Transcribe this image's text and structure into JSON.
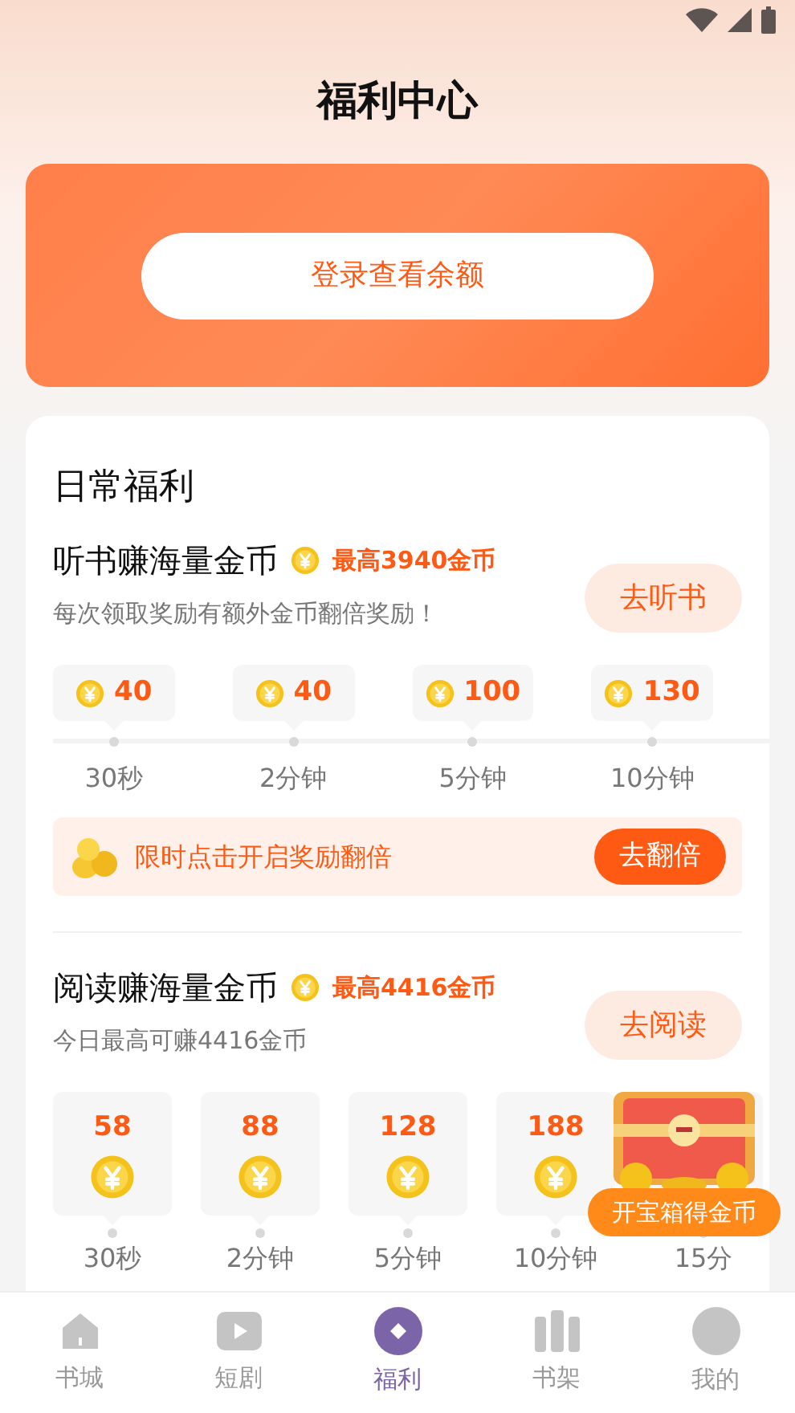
{
  "title": "福利中心",
  "balance_card": {
    "login_button": "登录查看余额"
  },
  "daily": {
    "heading": "日常福利",
    "tasks": [
      {
        "kind": "chips",
        "title": "听书赚海量金币",
        "max_reward": "最高3940金币",
        "subtitle": "每次领取奖励有额外金币翻倍奖励！",
        "button": "去听书",
        "milestones": [
          {
            "reward": "40",
            "time": "30秒"
          },
          {
            "reward": "40",
            "time": "2分钟"
          },
          {
            "reward": "100",
            "time": "5分钟"
          },
          {
            "reward": "130",
            "time": "10分钟"
          }
        ],
        "promo": {
          "text": "限时点击开启奖励翻倍",
          "button": "去翻倍"
        }
      },
      {
        "kind": "cards",
        "title": "阅读赚海量金币",
        "max_reward": "最高4416金币",
        "subtitle": "今日最高可赚4416金币",
        "button": "去阅读",
        "milestones": [
          {
            "reward": "58",
            "time": "30秒"
          },
          {
            "reward": "88",
            "time": "2分钟"
          },
          {
            "reward": "128",
            "time": "5分钟"
          },
          {
            "reward": "188",
            "time": "10分钟"
          },
          {
            "time": "15分"
          }
        ]
      }
    ]
  },
  "treasure_chest": {
    "button": "开宝箱得金币"
  },
  "bottom_nav": [
    {
      "label": "书城",
      "selected": false
    },
    {
      "label": "短剧",
      "selected": false
    },
    {
      "label": "福利",
      "selected": true
    },
    {
      "label": "书架",
      "selected": false
    },
    {
      "label": "我的",
      "selected": false
    }
  ]
}
